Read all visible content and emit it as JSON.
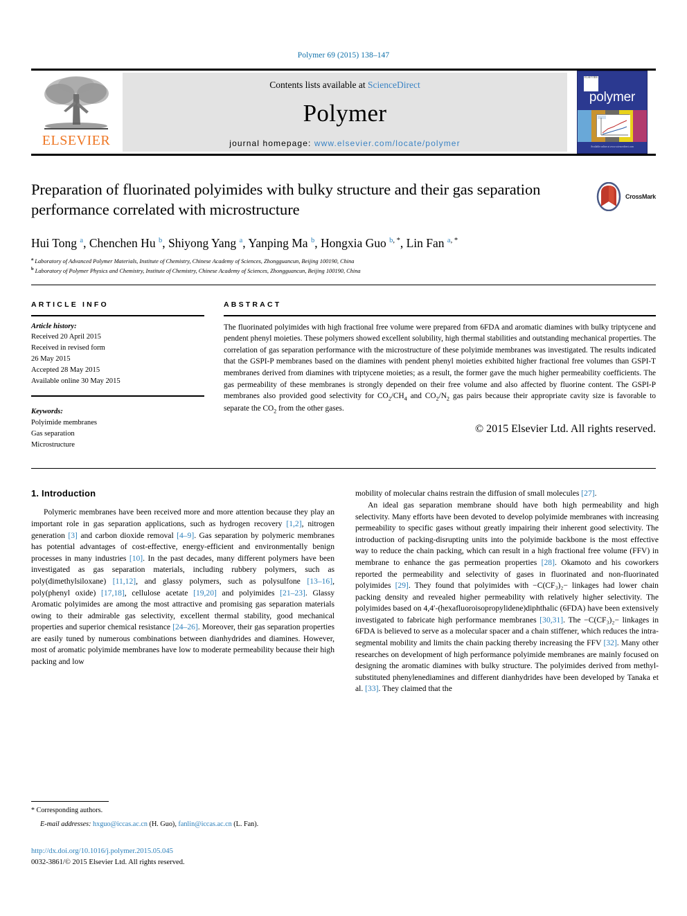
{
  "running_head": "Polymer 69 (2015) 138–147",
  "masthead": {
    "publisher_logo_label": "ELSEVIER",
    "contents_prefix": "Contents lists available at ",
    "contents_link": "ScienceDirect",
    "journal_name": "Polymer",
    "homepage_prefix": "journal homepage: ",
    "homepage_url": "www.elsevier.com/locate/polymer",
    "cover": {
      "title": "polymer",
      "publisher_mark": "ELSEVIER",
      "footer": "Available online at www.sciencedirect.com"
    }
  },
  "article": {
    "title": "Preparation of fluorinated polyimides with bulky structure and their gas separation performance correlated with microstructure",
    "crossmark_label": "CrossMark",
    "authors_html": "Hui Tong <sup>a</sup>, Chenchen Hu <sup>b</sup>, Shiyong Yang <sup>a</sup>, Yanping Ma <sup>b</sup>, Hongxia Guo <sup>b, *</sup>, Lin Fan <sup>a, *</sup>",
    "affiliations": [
      "a Laboratory of Advanced Polymer Materials, Institute of Chemistry, Chinese Academy of Sciences, Zhongguancun, Beijing 100190, China",
      "b Laboratory of Polymer Physics and Chemistry, Institute of Chemistry, Chinese Academy of Sciences, Zhongguancun, Beijing 100190, China"
    ]
  },
  "article_info": {
    "heading": "ARTICLE INFO",
    "history_label": "Article history:",
    "history": [
      "Received 20 April 2015",
      "Received in revised form",
      "26 May 2015",
      "Accepted 28 May 2015",
      "Available online 30 May 2015"
    ],
    "keywords_label": "Keywords:",
    "keywords": [
      "Polyimide membranes",
      "Gas separation",
      "Microstructure"
    ]
  },
  "abstract": {
    "heading": "ABSTRACT",
    "text_part1": "The fluorinated polyimides with high fractional free volume were prepared from 6FDA and aromatic diamines with bulky triptycene and pendent phenyl moieties. These polymers showed excellent solubility, high thermal stabilities and outstanding mechanical properties. The correlation of gas separation performance with the microstructure of these polyimide membranes was investigated. The results indicated that the GSPI-P membranes based on the diamines with pendent phenyl moieties exhibited higher fractional free volumes than GSPI-T membranes derived from diamines with triptycene moieties; as a result, the former gave the much higher permeability coefficients. The gas permeability of these membranes is strongly depended on their free volume and also affected by fluorine content. The GSPI-P membranes also provided good selectivity for CO",
    "sub1": "2",
    "text_part2": "/CH",
    "sub2": "4",
    "text_part3": " and CO",
    "sub3": "2",
    "text_part4": "/N",
    "sub4": "2",
    "text_part5": " gas pairs because their appropriate cavity size is favorable to separate the CO",
    "sub5": "2",
    "text_part6": " from the other gases.",
    "copyright": "© 2015 Elsevier Ltd. All rights reserved."
  },
  "body": {
    "section_heading": "1. Introduction",
    "left_paragraphs": [
      {
        "parts": [
          {
            "t": "Polymeric membranes have been received more and more attention because they play an important role in gas separation applications, such as hydrogen recovery "
          },
          {
            "t": "[1,2]",
            "ref": true
          },
          {
            "t": ", nitrogen generation "
          },
          {
            "t": "[3]",
            "ref": true
          },
          {
            "t": " and carbon dioxide removal "
          },
          {
            "t": "[4–9]",
            "ref": true
          },
          {
            "t": ". Gas separation by polymeric membranes has potential advantages of cost-effective, energy-efficient and environmentally benign processes in many industries "
          },
          {
            "t": "[10]",
            "ref": true
          },
          {
            "t": ". In the past decades, many different polymers have been investigated as gas separation materials, including rubbery polymers, such as poly(dimethylsiloxane) "
          },
          {
            "t": "[11,12]",
            "ref": true
          },
          {
            "t": ", and glassy polymers, such as polysulfone "
          },
          {
            "t": "[13–16]",
            "ref": true
          },
          {
            "t": ", poly(phenyl oxide) "
          },
          {
            "t": "[17,18]",
            "ref": true
          },
          {
            "t": ", cellulose acetate "
          },
          {
            "t": "[19,20]",
            "ref": true
          },
          {
            "t": " and polyimides "
          },
          {
            "t": "[21–23]",
            "ref": true
          },
          {
            "t": ". Glassy Aromatic polyimides are among the most attractive and promising gas separation materials owing to their admirable gas selectivity, excellent thermal stability, good mechanical properties and superior chemical resistance "
          },
          {
            "t": "[24–26]",
            "ref": true
          },
          {
            "t": ". Moreover, their gas separation properties are easily tuned by numerous combinations between dianhydrides and diamines. However, most of aromatic polyimide membranes have low to moderate permeability because their high packing and low"
          }
        ]
      }
    ],
    "right_paragraphs": [
      {
        "indent": false,
        "parts": [
          {
            "t": "mobility of molecular chains restrain the diffusion of small molecules "
          },
          {
            "t": "[27]",
            "ref": true
          },
          {
            "t": "."
          }
        ]
      },
      {
        "indent": true,
        "parts": [
          {
            "t": "An ideal gas separation membrane should have both high permeability and high selectivity. Many efforts have been devoted to develop polyimide membranes with increasing permeability to specific gases without greatly impairing their inherent good selectivity. The introduction of packing-disrupting units into the polyimide backbone is the most effective way to reduce the chain packing, which can result in a high fractional free volume (FFV) in membrane to enhance the gas permeation properties "
          },
          {
            "t": "[28]",
            "ref": true
          },
          {
            "t": ". Okamoto and his coworkers reported the permeability and selectivity of gases in fluorinated and non-fluorinated polyimides "
          },
          {
            "t": "[29]",
            "ref": true
          },
          {
            "t": ". They found that polyimides with −C(CF₃)₂− linkages had lower chain packing density and revealed higher permeability with relatively higher selectivity. The polyimides based on 4,4′-(hexafluoroisopropylidene)diphthalic (6FDA) have been extensively investigated to fabricate high performance membranes "
          },
          {
            "t": "[30,31]",
            "ref": true
          },
          {
            "t": ". The −C(CF₃)₂− linkages in 6FDA is believed to serve as a molecular spacer and a chain stiffener, which reduces the intra-segmental mobility and limits the chain packing thereby increasing the FFV "
          },
          {
            "t": "[32]",
            "ref": true
          },
          {
            "t": ". Many other researches on development of high performance polyimide membranes are mainly focused on designing the aromatic diamines with bulky structure. The polyimides derived from methyl-substituted phenylenediamines and different dianhydrides have been developed by Tanaka et al. "
          },
          {
            "t": "[33]",
            "ref": true
          },
          {
            "t": ". They claimed that the"
          }
        ]
      }
    ]
  },
  "footnote": {
    "corresponding_star": "*",
    "corresponding_text": " Corresponding authors.",
    "email_label": "E-mail addresses:",
    "email1": "hxguo@iccas.ac.cn",
    "email1_who": "(H. Guo)",
    "email2": "fanlin@iccas.ac.cn",
    "email2_who": "(L. Fan)",
    "doi": "http://dx.doi.org/10.1016/j.polymer.2015.05.045",
    "issn_line": "0032-3861/© 2015 Elsevier Ltd. All rights reserved."
  },
  "colors": {
    "link_blue": "#2b7fba",
    "elsevier_orange": "#ee7623",
    "cover_blue": "#2b3990",
    "masthead_gray": "#e3e3e3"
  }
}
